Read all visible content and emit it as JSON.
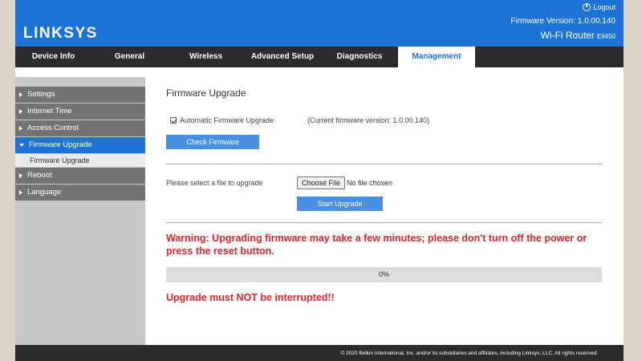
{
  "header": {
    "logo": "LINKSYS",
    "logout_label": "Logout",
    "firmware_version": "Firmware Version: 1.0.00.140",
    "router_name": "Wi-Fi Router",
    "router_model": "E9450"
  },
  "nav": {
    "tabs": [
      {
        "label": "Device Info"
      },
      {
        "label": "General"
      },
      {
        "label": "Wireless"
      },
      {
        "label": "Advanced Setup"
      },
      {
        "label": "Diagnostics"
      },
      {
        "label": "Management",
        "active": true
      }
    ]
  },
  "sidebar": {
    "items": [
      {
        "label": "Settings"
      },
      {
        "label": "Internet Time"
      },
      {
        "label": "Access Control"
      },
      {
        "label": "Firmware Upgrade",
        "active": true,
        "subitems": [
          {
            "label": "Firmware Upgrade"
          }
        ]
      },
      {
        "label": "Reboot"
      },
      {
        "label": "Language"
      }
    ]
  },
  "main": {
    "title": "Firmware Upgrade",
    "auto_upgrade": {
      "label": "Automatic Firmware Upgrade",
      "checked": true
    },
    "current_firmware": "(Current firmware version: 1.0.00.140)",
    "check_button": "Check Firmware",
    "select_label": "Please select a file to upgrade",
    "choose_button": "Choose File",
    "no_file": "No file chosen",
    "start_button": "Start Upgrade",
    "warning": "Warning: Upgrading firmware may take a few minutes; please don't turn off the power or press the reset button.",
    "progress": {
      "value": 0,
      "label": "0%"
    },
    "interrupt_warning": "Upgrade must NOT be interrupted!!"
  },
  "footer": {
    "copyright": "© 2020 Belkin International, Inc. and/or its subsidiaries and affiliates, including Linksys, LLC. All rights reserved."
  },
  "colors": {
    "brand_blue": "#1d73d6",
    "button_blue": "#4a90e2",
    "nav_dark": "#2c2c2c",
    "warning_red": "#e3232b"
  }
}
